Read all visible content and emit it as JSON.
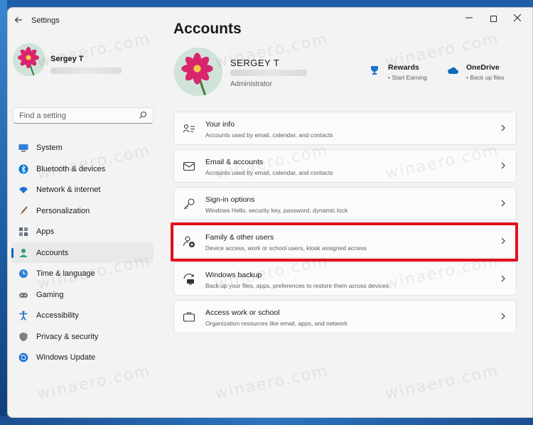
{
  "window": {
    "title": "Settings",
    "controls": {
      "minimize": "—",
      "close": "✕"
    }
  },
  "sidebar": {
    "profile": {
      "name": "Sergey T"
    },
    "search": {
      "placeholder": "Find a setting"
    },
    "items": [
      {
        "label": "System",
        "icon": "monitor-icon",
        "color": "#2f7fd8"
      },
      {
        "label": "Bluetooth & devices",
        "icon": "bluetooth-icon",
        "color": "#0078d4"
      },
      {
        "label": "Network & internet",
        "icon": "wifi-icon",
        "color": "#1c72cf"
      },
      {
        "label": "Personalization",
        "icon": "brush-icon",
        "color": "#d9743a"
      },
      {
        "label": "Apps",
        "icon": "apps-icon",
        "color": "#5f6b7a"
      },
      {
        "label": "Accounts",
        "icon": "person-icon",
        "color": "#2aa37a",
        "active": true
      },
      {
        "label": "Time & language",
        "icon": "globe-clock-icon",
        "color": "#2f7fd8"
      },
      {
        "label": "Gaming",
        "icon": "gamepad-icon",
        "color": "#7a7a7a"
      },
      {
        "label": "Accessibility",
        "icon": "accessibility-icon",
        "color": "#1a6fc9"
      },
      {
        "label": "Privacy & security",
        "icon": "shield-icon",
        "color": "#7b7f86"
      },
      {
        "label": "Windows Update",
        "icon": "update-icon",
        "color": "#1a73d1"
      }
    ]
  },
  "main": {
    "title": "Accounts",
    "user": {
      "name": "SERGEY T",
      "role": "Administrator"
    },
    "quick_links": [
      {
        "title": "Rewards",
        "subtitle": "Start Earning",
        "icon": "rewards-trophy-icon",
        "color": "#1a73d1"
      },
      {
        "title": "OneDrive",
        "subtitle": "Back up files",
        "icon": "onedrive-cloud-icon",
        "color": "#0f6cbd"
      }
    ],
    "cards": [
      {
        "title": "Your info",
        "subtitle": "Accounts used by email, calendar, and contacts",
        "icon": "person-card-icon"
      },
      {
        "title": "Email & accounts",
        "subtitle": "Accounts used by email, calendar, and contacts",
        "icon": "mail-icon"
      },
      {
        "title": "Sign-in options",
        "subtitle": "Windows Hello, security key, password, dynamic lock",
        "icon": "key-icon"
      },
      {
        "title": "Family & other users",
        "subtitle": "Device access, work or school users, kiosk assigned access",
        "icon": "person-add-icon",
        "highlighted": true
      },
      {
        "title": "Windows backup",
        "subtitle": "Back up your files, apps, preferences to restore them across devices",
        "icon": "backup-icon"
      },
      {
        "title": "Access work or school",
        "subtitle": "Organization resources like email, apps, and network",
        "icon": "briefcase-icon"
      }
    ]
  },
  "watermark": {
    "text": "winaero.com"
  },
  "colors": {
    "accent": "#0067c0",
    "highlight": "#e3101c",
    "background": "#f3f3f3"
  }
}
